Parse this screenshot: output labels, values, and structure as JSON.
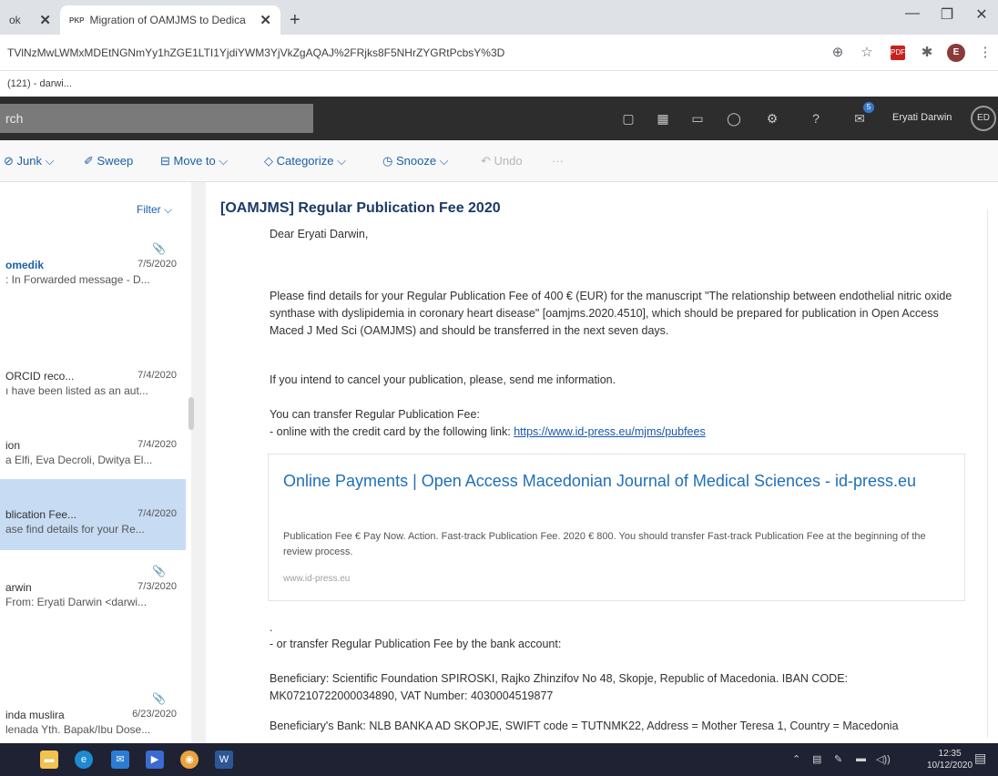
{
  "browser": {
    "tab1_title": "ok",
    "tab2_favicon": "PKP",
    "tab2_title": "Migration of OAMJMS to Dedica",
    "url": "TVlNzMwLWMxMDEtNGNmYy1hZGE1LTI1YjdiYWM3YjVkZgAQAJ%2FRjks8F5NHrZYGRtPcbsY%3D",
    "bookmark": "(121) - darwi..."
  },
  "outlook": {
    "search_text": "rch",
    "user_name": "Eryati Darwin",
    "user_initials": "ED",
    "notification_count": "5"
  },
  "commands": {
    "junk": "Junk",
    "sweep": "Sweep",
    "move_to": "Move to",
    "categorize": "Categorize",
    "snooze": "Snooze",
    "undo": "Undo",
    "more": "···"
  },
  "list": {
    "filter": "Filter",
    "items": [
      {
        "from": "omedik",
        "date": "7/5/2020",
        "preview": ": In Forwarded message - D..."
      },
      {
        "from": "ORCID reco...",
        "date": "7/4/2020",
        "preview": "ı have been listed as an aut..."
      },
      {
        "from": "ion",
        "date": "7/4/2020",
        "preview": "a Elfi, Eva Decroli, Dwitya El..."
      },
      {
        "from": "blication Fee...",
        "date": "7/4/2020",
        "preview": "ase find details for your Re..."
      },
      {
        "from": "arwin",
        "date": "7/3/2020",
        "preview": "From: Eryati Darwin <darwi..."
      },
      {
        "from": "inda muslira",
        "date": "6/23/2020",
        "preview": "lenada Yth. Bapak/Ibu Dose..."
      }
    ]
  },
  "email": {
    "subject": "[OAMJMS] Regular Publication Fee 2020",
    "greeting": "Dear Eryati Darwin,",
    "para1": "Please find details for your Regular Publication Fee of 400 € (EUR) for the manuscript \"The relationship between endothelial nitric oxide synthase with dyslipidemia in coronary heart disease\" [oamjms.2020.4510], which should be prepared for publication in Open Access Maced J Med Sci (OAMJMS) and should be transferred in the next seven days.",
    "para2": "If you intend to cancel your publication, please, send me information.",
    "para3_line1": "You can transfer Regular Publication Fee:",
    "para3_line2": "- online with the credit card by the following link: ",
    "link": "https://www.id-press.eu/mjms/pubfees",
    "card_title": "Online Payments | Open Access Macedonian Journal of Medical Sciences - id-press.eu",
    "card_desc": "Publication Fee € Pay Now. Action. Fast-track Publication Fee. 2020 € 800. You should transfer Fast-track Publication Fee at the beginning of the review process.",
    "card_site": "www.id-press.eu",
    "dot": ".",
    "bank_intro": "- or transfer Regular Publication Fee by the bank account:",
    "beneficiary": "Beneficiary: Scientific Foundation SPIROSKI, Rajko Zhinzifov No 48, Skopje, Republic of Macedonia. IBAN CODE: MK07210722000034890, VAT Number: 4030004519877",
    "bank": "Beneficiary's Bank: NLB BANKA AD SKOPJE, SWIFT code = TUTNMK22, Address = Mother Teresa 1, Country = Macedonia"
  },
  "taskbar": {
    "time": "12:35",
    "date": "10/12/2020",
    "word_label": "W"
  }
}
